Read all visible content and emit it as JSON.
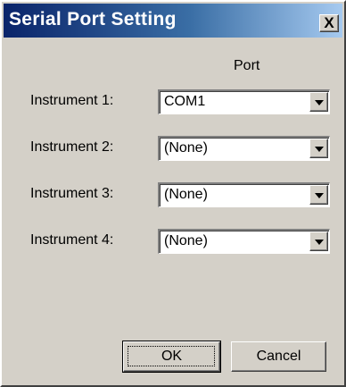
{
  "window": {
    "title": "Serial Port Setting",
    "close_label": "X"
  },
  "form": {
    "column_header": "Port",
    "rows": [
      {
        "label": "Instrument 1:",
        "value": "COM1"
      },
      {
        "label": "Instrument 2:",
        "value": "(None)"
      },
      {
        "label": "Instrument 3:",
        "value": "(None)"
      },
      {
        "label": "Instrument 4:",
        "value": "(None)"
      }
    ]
  },
  "buttons": {
    "ok_label": "OK",
    "cancel_label": "Cancel"
  },
  "colors": {
    "face": "#d4d0c8",
    "title_start": "#0a246a",
    "title_end": "#a6caf0"
  }
}
